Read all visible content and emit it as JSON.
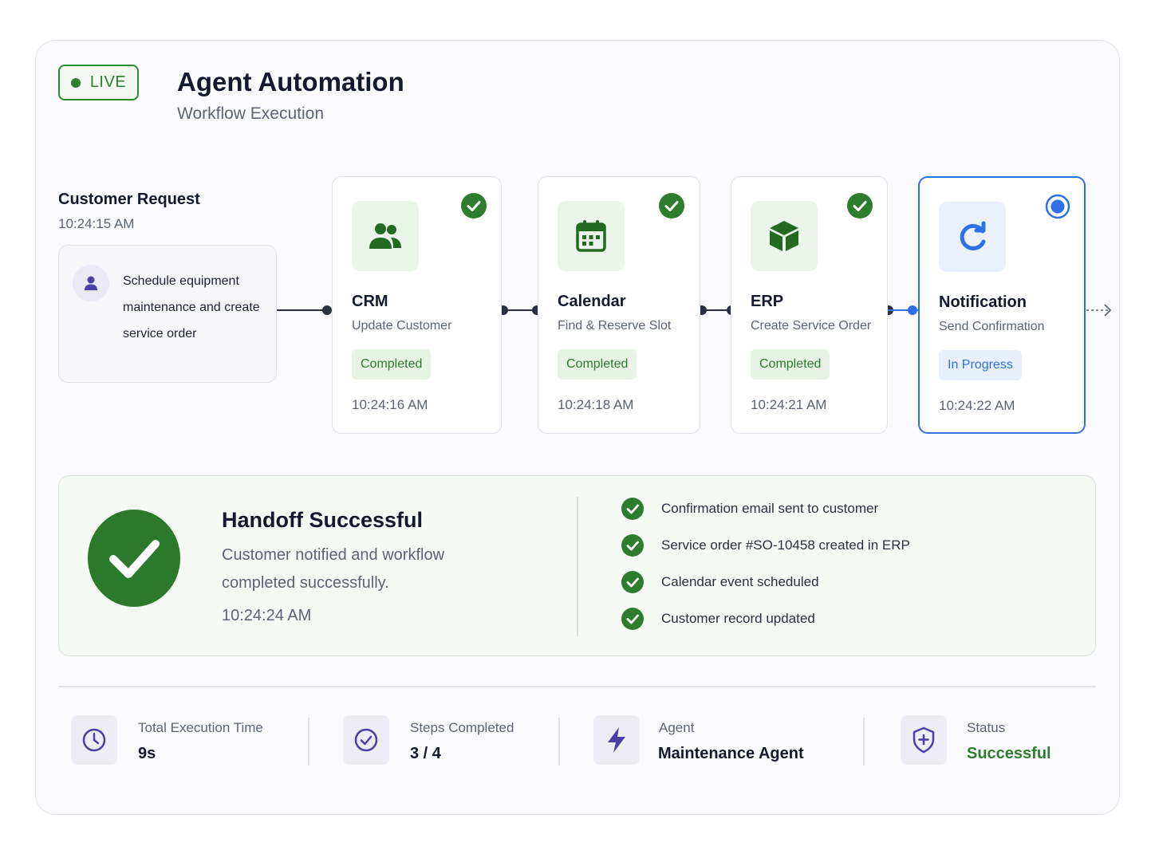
{
  "header": {
    "live_label": "LIVE",
    "title": "Agent Automation",
    "subtitle": "Workflow Execution"
  },
  "request": {
    "title": "Customer Request",
    "time": "10:24:15 AM",
    "text": "Schedule equipment maintenance and create service order",
    "icon": "user-icon"
  },
  "steps": [
    {
      "name": "CRM",
      "action": "Update Customer",
      "status": "Completed",
      "time": "10:24:16 AM",
      "icon": "users-icon"
    },
    {
      "name": "Calendar",
      "action": "Find & Reserve Slot",
      "status": "Completed",
      "time": "10:24:18 AM",
      "icon": "calendar-icon"
    },
    {
      "name": "ERP",
      "action": "Create Service Order",
      "status": "Completed",
      "time": "10:24:21 AM",
      "icon": "box-icon"
    },
    {
      "name": "Notification",
      "action": "Send Confirmation",
      "status": "In Progress",
      "time": "10:24:22 AM",
      "icon": "refresh-icon"
    }
  ],
  "handoff": {
    "title": "Handoff Successful",
    "description": "Customer notified and workflow completed successfully.",
    "time": "10:24:24 AM",
    "checklist": [
      "Confirmation email sent to customer",
      "Service order #SO-10458 created in ERP",
      "Calendar event scheduled",
      "Customer record updated"
    ]
  },
  "stats": [
    {
      "label": "Total Execution Time",
      "value": "9s",
      "icon": "clock-icon"
    },
    {
      "label": "Steps Completed",
      "value": "3 / 4",
      "icon": "check-circle-icon"
    },
    {
      "label": "Agent",
      "value": "Maintenance Agent",
      "icon": "lightning-icon"
    },
    {
      "label": "Status",
      "value": "Successful",
      "icon": "shield-icon"
    }
  ],
  "colors": {
    "success": "#2e7d2e",
    "active": "#2f6fe8",
    "accent": "#4b3fa8"
  }
}
